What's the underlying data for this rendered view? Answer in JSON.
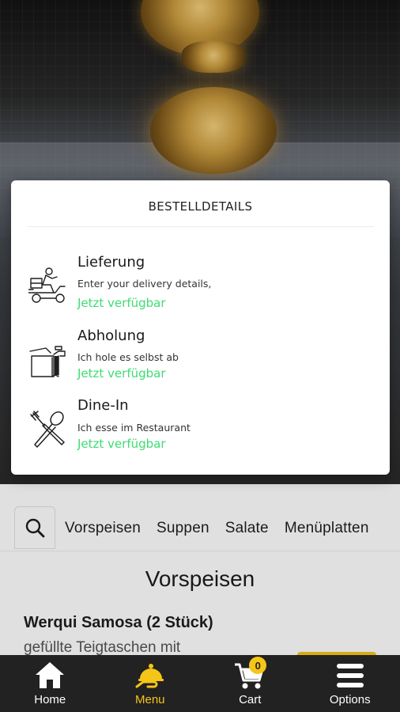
{
  "modal": {
    "title": "BESTELLDETAILS",
    "options": [
      {
        "title": "Lieferung",
        "subtitle": "Enter your delivery details,",
        "status": "Jetzt verfügbar",
        "icon": "delivery-scooter-icon"
      },
      {
        "title": "Abholung",
        "subtitle": "Ich hole es selbst ab",
        "status": "Jetzt verfügbar",
        "icon": "pickup-bag-icon"
      },
      {
        "title": "Dine-In",
        "subtitle": "Ich esse im Restaurant",
        "status": "Jetzt verfügbar",
        "icon": "fork-spoon-icon"
      }
    ],
    "status_color": "#3ddc72"
  },
  "categories": {
    "search_icon": "search-icon",
    "items": [
      "Vorspeisen",
      "Suppen",
      "Salate",
      "Menüplatten"
    ]
  },
  "section": {
    "title": "Vorspeisen",
    "item_name": "Werqui Samosa (2 Stück)",
    "item_desc": "gefüllte Teigtaschen mit"
  },
  "bottom_nav": {
    "items": [
      {
        "label": "Home",
        "icon": "home-icon",
        "active": false
      },
      {
        "label": "Menu",
        "icon": "menu-cloche-icon",
        "active": true
      },
      {
        "label": "Cart",
        "icon": "cart-icon",
        "active": false,
        "badge": "0"
      },
      {
        "label": "Options",
        "icon": "hamburger-icon",
        "active": false
      }
    ],
    "accent": "#f5c518",
    "background": "#222222"
  }
}
